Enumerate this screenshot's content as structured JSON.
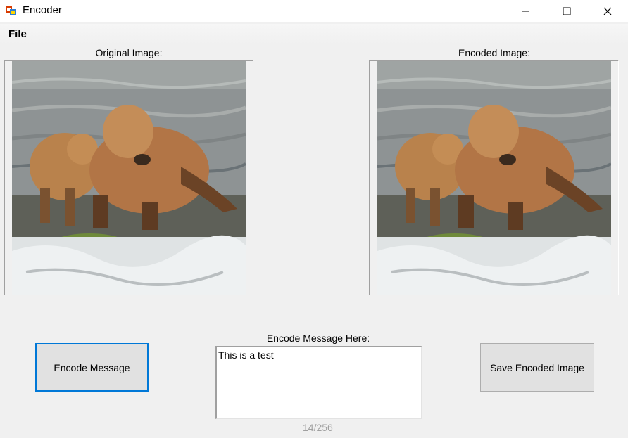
{
  "window": {
    "title": "Encoder",
    "controls": {
      "minimize": "minimize-icon",
      "maximize": "maximize-icon",
      "close": "close-icon"
    }
  },
  "menu": {
    "items": [
      {
        "label": "File"
      }
    ]
  },
  "original": {
    "label": "Original Image:"
  },
  "encoded": {
    "label": "Encoded Image:"
  },
  "message": {
    "label": "Encode Message Here:",
    "value": "This is a test",
    "counter": "14/256"
  },
  "buttons": {
    "encode": "Encode Message",
    "save": "Save Encoded Image"
  },
  "colors": {
    "focus": "#0078d7",
    "window_bg": "#f0f0f0",
    "button_bg": "#e1e1e1"
  }
}
